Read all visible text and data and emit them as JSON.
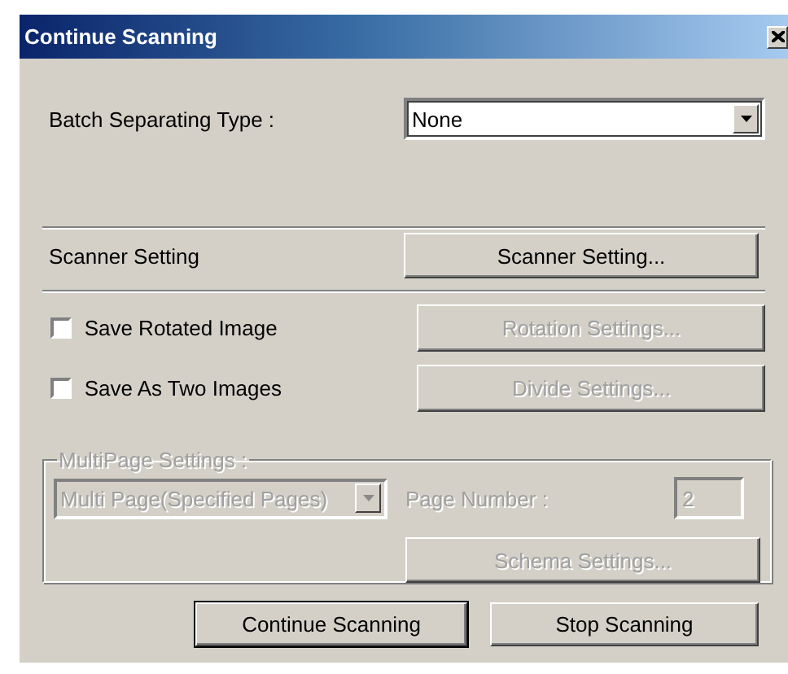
{
  "window": {
    "title": "Continue Scanning"
  },
  "batch_separating": {
    "label": "Batch Separating Type :",
    "value": "None"
  },
  "scanner_setting": {
    "label": "Scanner Setting",
    "button": "Scanner Setting..."
  },
  "options": [
    {
      "label": "Save Rotated Image",
      "checked": false,
      "button": "Rotation Settings...",
      "button_disabled": true
    },
    {
      "label": "Save As Two Images",
      "checked": false,
      "button": "Divide Settings...",
      "button_disabled": true
    }
  ],
  "multipage": {
    "legend": "MultiPage Settings :",
    "disabled": true,
    "mode": "Multi Page(Specified Pages)",
    "page_number_label": "Page Number :",
    "page_number": "2",
    "schema_button": "Schema Settings..."
  },
  "buttons": [
    {
      "label": "Continue Scanning",
      "default": true
    },
    {
      "label": "Stop Scanning",
      "default": false
    }
  ]
}
